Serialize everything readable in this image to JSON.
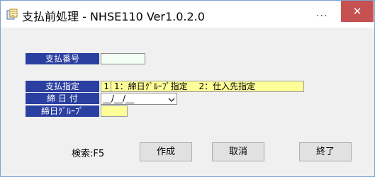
{
  "window": {
    "title": "支払前処理 - NHSE110 Ver1.0.2.0",
    "more_label": "...",
    "close_label": "✕"
  },
  "form": {
    "shiharai_bango": {
      "label": "支払番号",
      "value": ""
    },
    "shiharai_shitei": {
      "label": "支払指定",
      "value": "1",
      "options_text": "1：締日ｸﾞﾙｰﾌﾟ指定　 2：仕入先指定"
    },
    "shime_hizuke": {
      "label": "締 日 付",
      "value": "__/__/__"
    },
    "shime_group": {
      "label": "締日ｸﾞﾙｰﾌﾟ",
      "value": ""
    }
  },
  "footer": {
    "search_hint": "検索:F5",
    "create_button": "作成",
    "cancel_button": "取消",
    "exit_button": "終了"
  },
  "colors": {
    "label_bg": "#2b3fa0",
    "highlight_field": "#ffff99",
    "input_field": "#f4fff4",
    "close_button": "#c75050"
  }
}
